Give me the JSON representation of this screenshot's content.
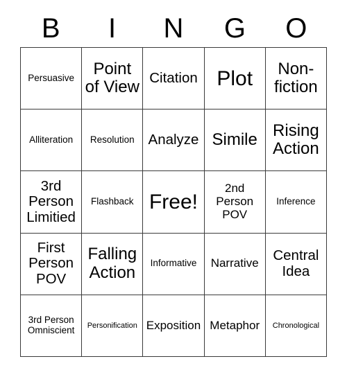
{
  "card": {
    "title": "BINGO",
    "header_letters": [
      "B",
      "I",
      "N",
      "G",
      "O"
    ],
    "columns": 5,
    "rows": 5,
    "colors": {
      "background": "#ffffff",
      "text": "#000000",
      "grid_line": "#3a3a3a"
    },
    "cells": [
      {
        "text": "Persuasive",
        "size": "sm"
      },
      {
        "text": "Point\nof View",
        "size": "xl"
      },
      {
        "text": "Citation",
        "size": "lg"
      },
      {
        "text": "Plot",
        "size": "xxl"
      },
      {
        "text": "Non-\nfiction",
        "size": "xl"
      },
      {
        "text": "Alliteration",
        "size": "sm"
      },
      {
        "text": "Resolution",
        "size": "sm"
      },
      {
        "text": "Analyze",
        "size": "lg"
      },
      {
        "text": "Simile",
        "size": "xl"
      },
      {
        "text": "Rising\nAction",
        "size": "xl"
      },
      {
        "text": "3rd\nPerson\nLimitied",
        "size": "lg"
      },
      {
        "text": "Flashback",
        "size": "sm"
      },
      {
        "text": "Free!",
        "size": "xxl"
      },
      {
        "text": "2nd\nPerson\nPOV",
        "size": "md"
      },
      {
        "text": "Inference",
        "size": "sm"
      },
      {
        "text": "First\nPerson\nPOV",
        "size": "lg"
      },
      {
        "text": "Falling\nAction",
        "size": "xl"
      },
      {
        "text": "Informative",
        "size": "sm"
      },
      {
        "text": "Narrative",
        "size": "md"
      },
      {
        "text": "Central\nIdea",
        "size": "lg"
      },
      {
        "text": "3rd Person\nOmniscient",
        "size": "sm"
      },
      {
        "text": "Personification",
        "size": "xs"
      },
      {
        "text": "Exposition",
        "size": "md"
      },
      {
        "text": "Metaphor",
        "size": "md"
      },
      {
        "text": "Chronological",
        "size": "xs"
      }
    ]
  }
}
